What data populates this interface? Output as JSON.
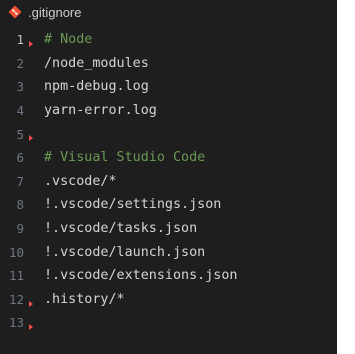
{
  "tab": {
    "title": ".gitignore",
    "icon": "git-diamond-icon",
    "icon_color": "#f05033"
  },
  "lines": [
    {
      "num": "1",
      "text": "# Node",
      "kind": "comment",
      "marker": true,
      "active": true
    },
    {
      "num": "2",
      "text": "/node_modules",
      "kind": "code",
      "marker": false,
      "active": false
    },
    {
      "num": "3",
      "text": "npm-debug.log",
      "kind": "code",
      "marker": false,
      "active": false
    },
    {
      "num": "4",
      "text": "yarn-error.log",
      "kind": "code",
      "marker": false,
      "active": false
    },
    {
      "num": "5",
      "text": "",
      "kind": "code",
      "marker": true,
      "active": false
    },
    {
      "num": "6",
      "text": "# Visual Studio Code",
      "kind": "comment",
      "marker": false,
      "active": false
    },
    {
      "num": "7",
      "text": ".vscode/*",
      "kind": "code",
      "marker": false,
      "active": false
    },
    {
      "num": "8",
      "text": "!.vscode/settings.json",
      "kind": "code",
      "marker": false,
      "active": false
    },
    {
      "num": "9",
      "text": "!.vscode/tasks.json",
      "kind": "code",
      "marker": false,
      "active": false
    },
    {
      "num": "10",
      "text": "!.vscode/launch.json",
      "kind": "code",
      "marker": false,
      "active": false
    },
    {
      "num": "11",
      "text": "!.vscode/extensions.json",
      "kind": "code",
      "marker": false,
      "active": false
    },
    {
      "num": "12",
      "text": ".history/*",
      "kind": "code",
      "marker": true,
      "active": false
    },
    {
      "num": "13",
      "text": "",
      "kind": "code",
      "marker": true,
      "active": false
    }
  ],
  "colors": {
    "background": "#1e1e1e",
    "text": "#d4d4d4",
    "comment": "#6a9955",
    "line_number": "#6e7681",
    "active_line_number": "#c6c6c6",
    "change_marker": "#f14c4c"
  }
}
